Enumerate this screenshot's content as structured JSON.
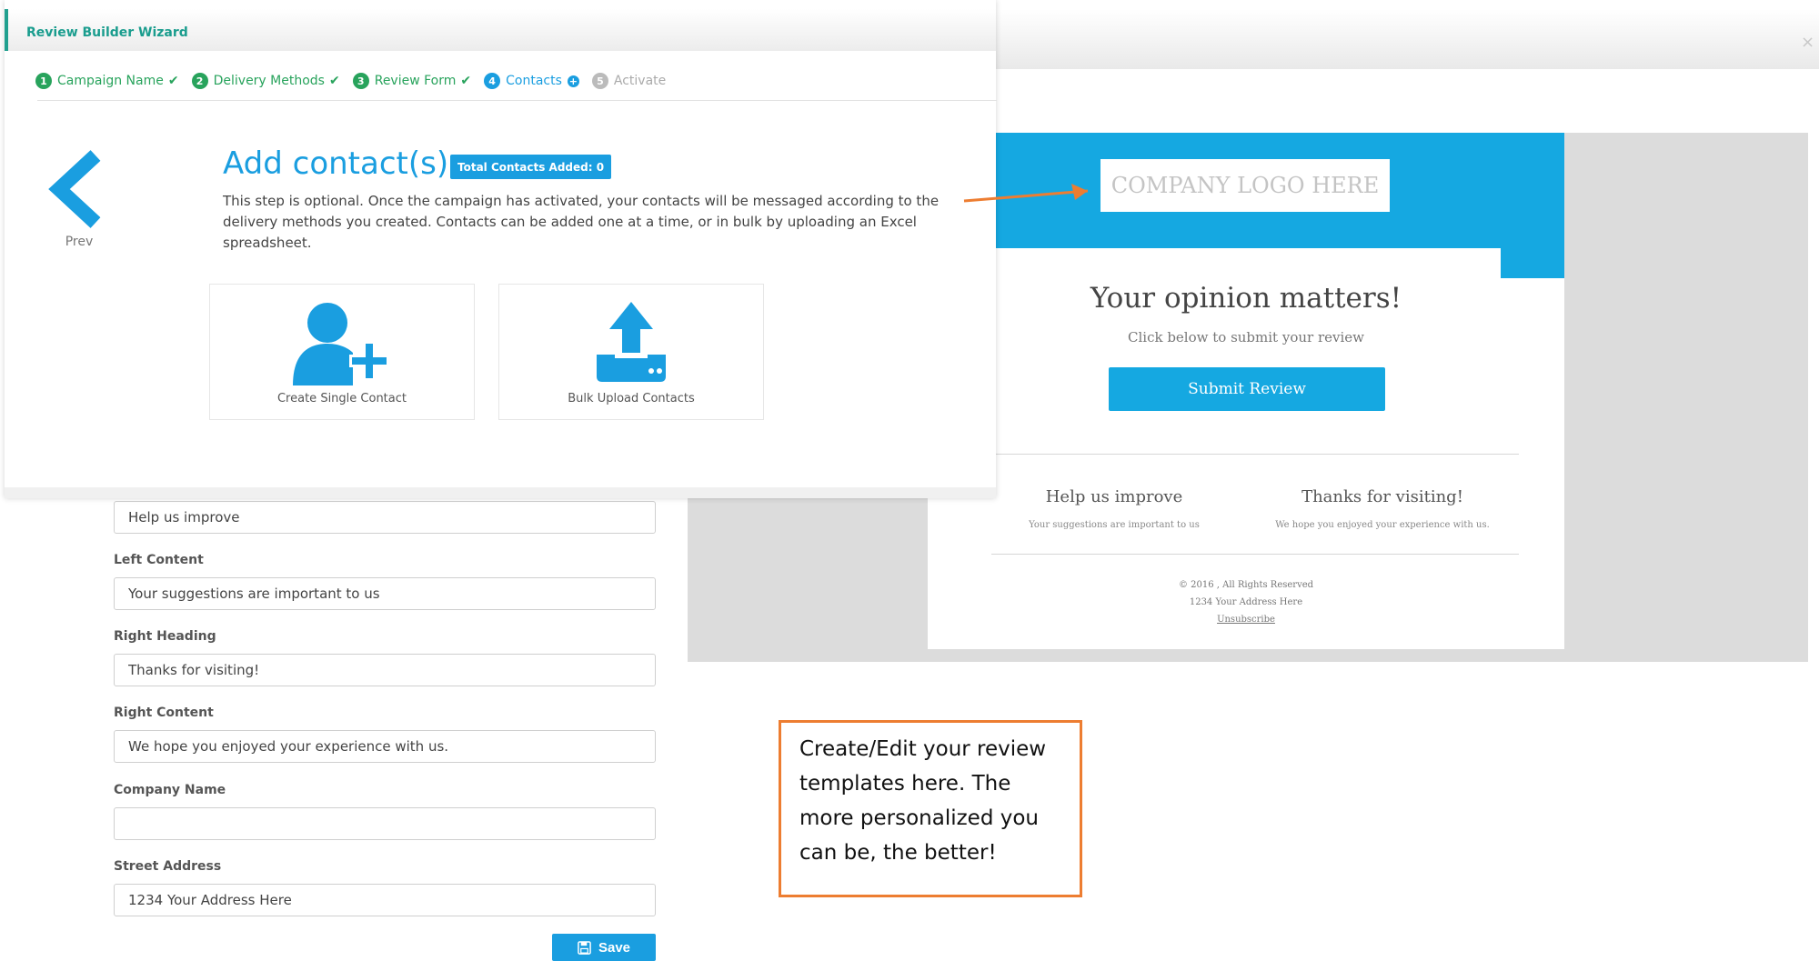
{
  "wizard": {
    "title": "Review Builder Wizard",
    "steps": [
      {
        "num": "1",
        "label": "Campaign Name",
        "state": "done"
      },
      {
        "num": "2",
        "label": "Delivery Methods",
        "state": "done"
      },
      {
        "num": "3",
        "label": "Review Form",
        "state": "done"
      },
      {
        "num": "4",
        "label": "Contacts",
        "state": "current"
      },
      {
        "num": "5",
        "label": "Activate",
        "state": "future"
      }
    ],
    "prev_label": "Prev",
    "heading": "Add contact(s)",
    "badge": "Total Contacts Added: 0",
    "description": "This step is optional. Once the campaign has activated, your contacts will be messaged according to the delivery methods you created. Contacts can be added one at a time, or in bulk by uploading an Excel spreadsheet.",
    "tiles": {
      "single": "Create Single Contact",
      "bulk": "Bulk Upload Contacts"
    }
  },
  "email_preview": {
    "logo_text": "COMPANY LOGO HERE",
    "title": "Your opinion matters!",
    "subtitle": "Click below to submit your review",
    "button": "Submit Review",
    "left_heading": "Help us improve",
    "left_content": "Your suggestions are important to us",
    "right_heading": "Thanks for visiting!",
    "right_content": "We hope you enjoyed your experience with us.",
    "copyright": "© 2016 , All Rights Reserved",
    "address": "1234 Your Address Here",
    "unsubscribe": "Unsubscribe"
  },
  "form": {
    "left_heading_value": "Help us improve",
    "left_content_label": "Left Content",
    "left_content_value": "Your suggestions are important to us",
    "right_heading_label": "Right Heading",
    "right_heading_value": "Thanks for visiting!",
    "right_content_label": "Right Content",
    "right_content_value": "We hope you enjoyed your experience with us.",
    "company_name_label": "Company Name",
    "company_name_value": "",
    "street_address_label": "Street Address",
    "street_address_value": "1234 Your Address Here",
    "save_label": "Save"
  },
  "callout": {
    "text": "Create/Edit your review templates here. The more personalized you can be, the better!"
  },
  "close_symbol": "×",
  "colors": {
    "brand_blue": "#1a9ee0",
    "email_header": "#15a8e1",
    "step_green": "#28a35c",
    "accent_orange": "#ed7d31",
    "header_teal": "#21a08f"
  }
}
